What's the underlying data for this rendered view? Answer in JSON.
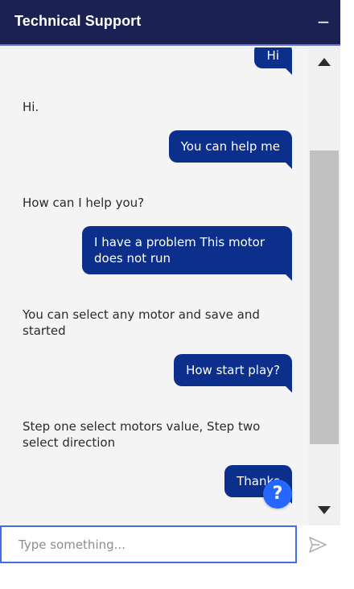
{
  "header": {
    "title": "Technical Support",
    "minimize_icon": "−"
  },
  "messages": [
    {
      "sender": "user",
      "text": "Hi"
    },
    {
      "sender": "bot",
      "text": "Hi."
    },
    {
      "sender": "user",
      "text": "You can help me"
    },
    {
      "sender": "bot",
      "text": "How can I help you?"
    },
    {
      "sender": "user",
      "text": "I have a problem This motor does not run"
    },
    {
      "sender": "bot",
      "text": "You can select any motor and save and started"
    },
    {
      "sender": "user",
      "text": "How start play?"
    },
    {
      "sender": "bot",
      "text": "Step one select motors value, Step two select direction"
    },
    {
      "sender": "user",
      "text": "Thanks"
    }
  ],
  "help": {
    "icon": "question-icon",
    "symbol": "?",
    "color": "#2667ff"
  },
  "input": {
    "placeholder": "Type something...",
    "value": ""
  },
  "colors": {
    "header_bg": "#1b2153",
    "user_bubble": "#0b2f8a",
    "input_border": "#3f6ee8"
  }
}
